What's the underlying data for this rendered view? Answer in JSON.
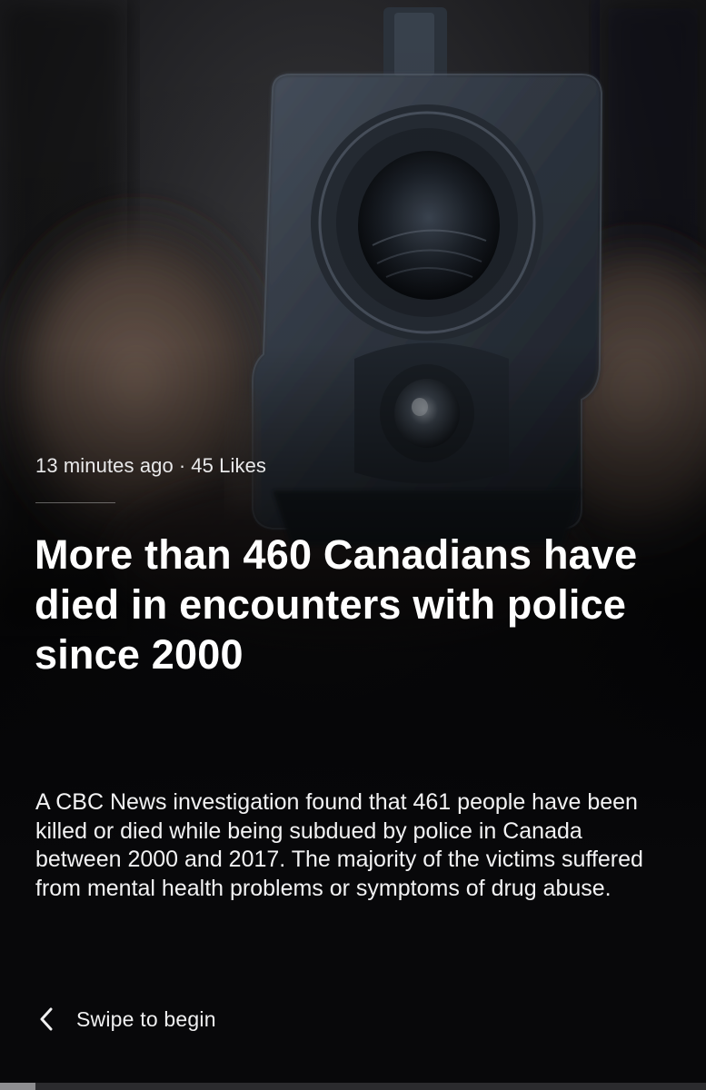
{
  "story": {
    "timestamp": "13 minutes ago",
    "separator": "·",
    "likes": "45 Likes",
    "headline": "More than 460 Canadians have died in encounters with police since 2000",
    "summary": "A CBC News investigation found that 461 people have been killed or died while being subdued by police in Canada between 2000 and 2017. The majority of the victims suffered from mental health problems or symptoms of drug abuse."
  },
  "navigation": {
    "swipe_label": "Swipe to begin",
    "swipe_icon": "chevron-left-icon"
  },
  "progress": {
    "fraction": 0.05
  },
  "hero_image": {
    "subject": "handgun muzzle pointed at viewer"
  }
}
